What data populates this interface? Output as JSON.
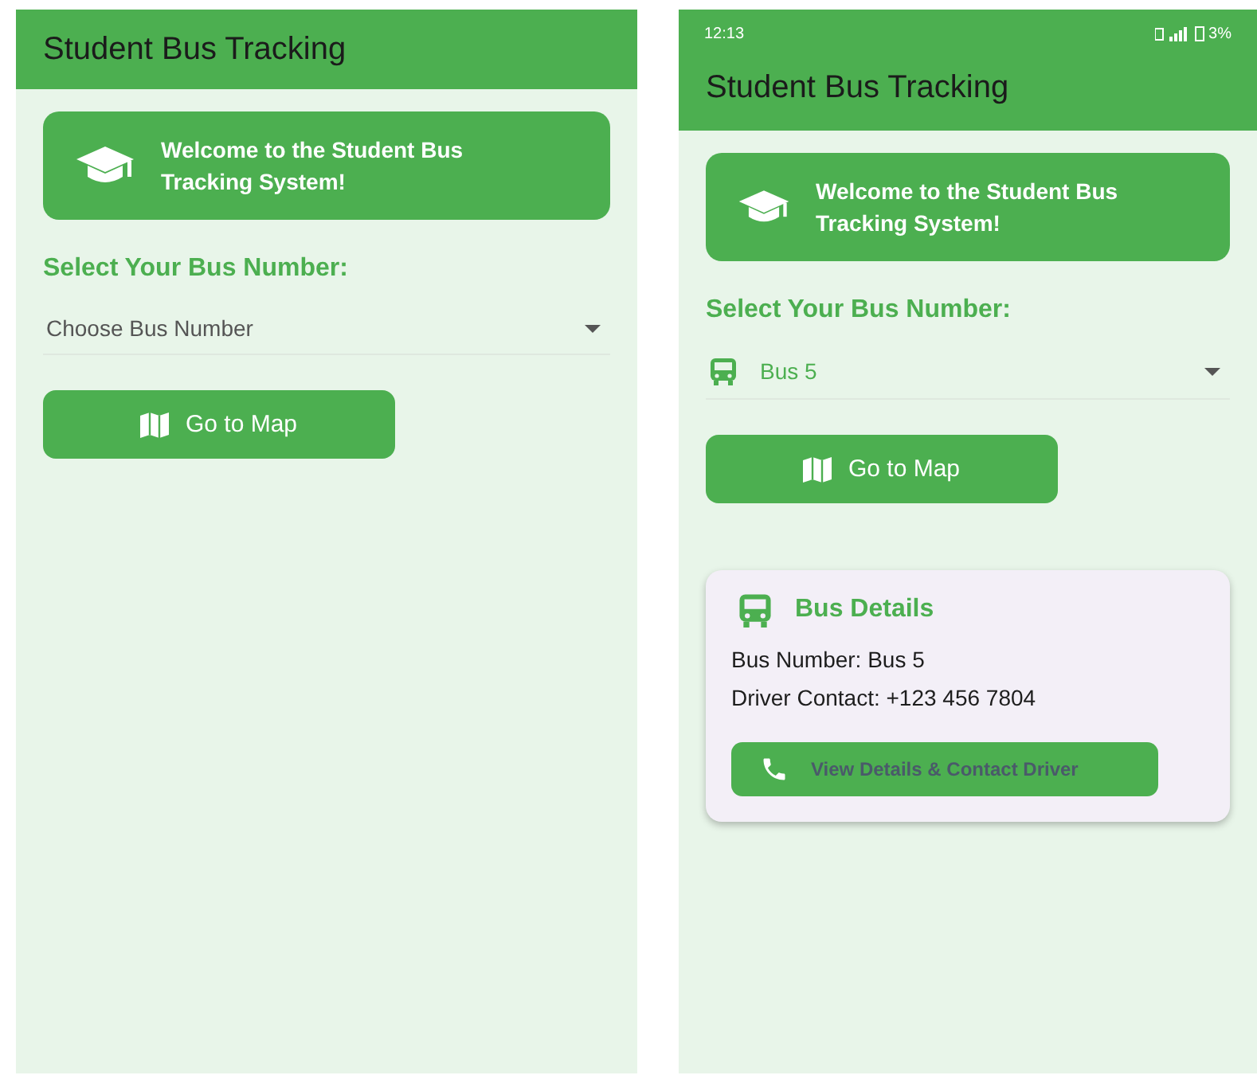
{
  "screens": [
    {
      "app_bar": {
        "title": "Student Bus Tracking"
      },
      "welcome": "Welcome to the Student Bus Tracking System!",
      "select_label": "Select Your Bus Number:",
      "bus_dropdown": {
        "placeholder": "Choose Bus Number"
      },
      "map_button": "Go to Map"
    },
    {
      "status_bar": {
        "time": "12:13",
        "battery": "3%"
      },
      "app_bar": {
        "title": "Student Bus Tracking"
      },
      "welcome": "Welcome to the Student Bus Tracking System!",
      "select_label": "Select Your Bus Number:",
      "bus_dropdown": {
        "value": "Bus 5"
      },
      "map_button": "Go to Map",
      "details_card": {
        "title": "Bus Details",
        "lines": [
          "Bus Number: Bus 5",
          "Driver Contact: +123 456 7804"
        ],
        "button": "View Details & Contact Driver"
      }
    }
  ]
}
